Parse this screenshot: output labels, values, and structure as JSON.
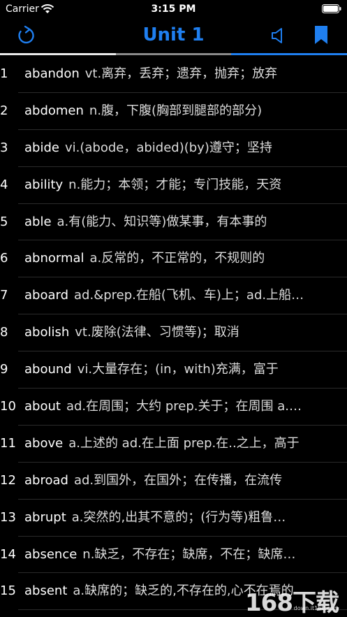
{
  "status_bar": {
    "carrier": "Carrier",
    "time": "3:15 PM"
  },
  "nav": {
    "title": "Unit 1"
  },
  "words": [
    {
      "index": "1",
      "word": "abandon",
      "definition": "vt.离弃，丢弃；遗弃，抛弃；放弃"
    },
    {
      "index": "2",
      "word": "abdomen",
      "definition": "n.腹，下腹(胸部到腿部的部分)"
    },
    {
      "index": "3",
      "word": "abide",
      "definition": "vi.(abode，abided)(by)遵守；坚持"
    },
    {
      "index": "4",
      "word": "ability",
      "definition": "n.能力；本领；才能；专门技能，天资"
    },
    {
      "index": "5",
      "word": "able",
      "definition": "a.有(能力、知识等)做某事，有本事的"
    },
    {
      "index": "6",
      "word": "abnormal",
      "definition": "a.反常的，不正常的，不规则的"
    },
    {
      "index": "7",
      "word": "aboard",
      "definition": "ad.&prep.在船(飞机、车)上；ad.上船…"
    },
    {
      "index": "8",
      "word": "abolish",
      "definition": "vt.废除(法律、习惯等)；取消"
    },
    {
      "index": "9",
      "word": "abound",
      "definition": "vi.大量存在；(in，with)充满，富于"
    },
    {
      "index": "10",
      "word": "about",
      "definition": "ad.在周围；大约 prep.关于；在周围 a.…"
    },
    {
      "index": "11",
      "word": "above",
      "definition": "a.上述的 ad.在上面  prep.在..之上，高于"
    },
    {
      "index": "12",
      "word": "abroad",
      "definition": "ad.到国外，在国外；在传播，在流传"
    },
    {
      "index": "13",
      "word": "abrupt",
      "definition": "a.突然的,出其不意的；(行为等)粗鲁…"
    },
    {
      "index": "14",
      "word": "absence",
      "definition": "n.缺乏，不存在；缺席，不在；缺席…"
    },
    {
      "index": "15",
      "word": "absent",
      "definition": "a.缺席的；缺乏的,不存在的,心不在焉的"
    }
  ],
  "watermark": {
    "text": "168下载",
    "sub": "down.it168.com"
  },
  "colors": {
    "accent": "#1f7ff0",
    "background": "#000000"
  }
}
